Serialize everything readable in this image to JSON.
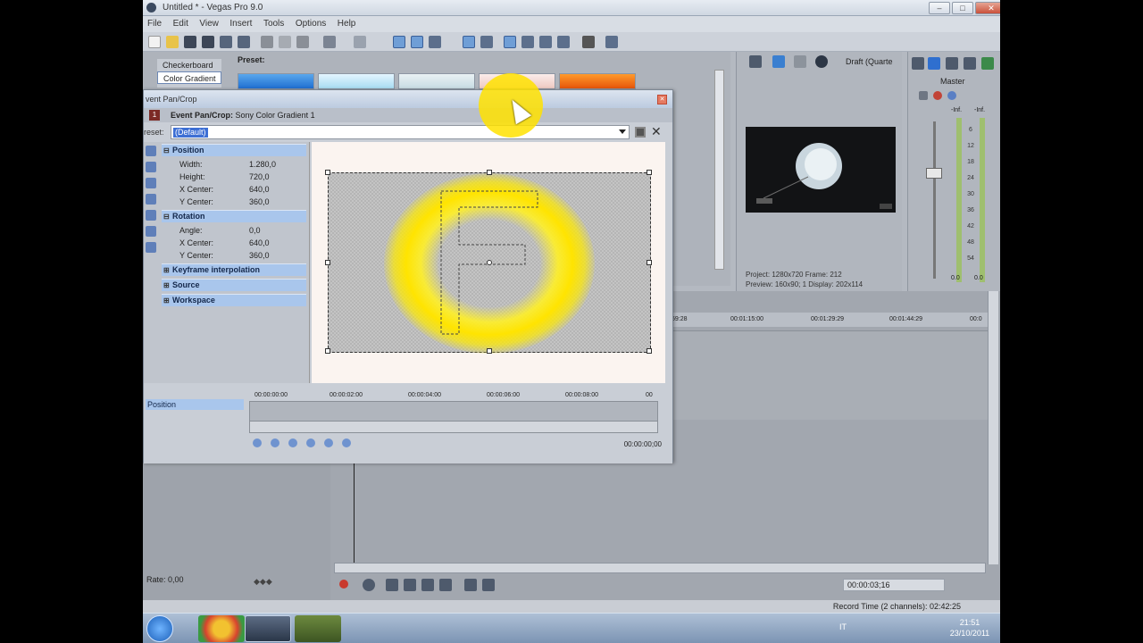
{
  "window": {
    "title": "Untitled * - Vegas Pro 9.0"
  },
  "menu": [
    "File",
    "Edit",
    "View",
    "Insert",
    "Tools",
    "Options",
    "Help"
  ],
  "media": {
    "tree": [
      "Checkerboard",
      "Color Gradient"
    ],
    "preset_label": "Preset:"
  },
  "preview": {
    "quality": "Draft (Quarte",
    "project_label": "Project:",
    "project_value": "1280x720",
    "frame_label": "Frame:",
    "frame_value": "212",
    "preview_label": "Preview:",
    "preview_value": "160x90; 1",
    "display_label": "Display:",
    "display_value": "202x114"
  },
  "master": {
    "label": "Master",
    "left_inf": "-Inf.",
    "right_inf": "-Inf.",
    "scale": [
      "6",
      "12",
      "18",
      "24",
      "30",
      "36",
      "42",
      "48",
      "54"
    ],
    "left_val": "0.0",
    "right_val": "0.0"
  },
  "dialog": {
    "title": "vent Pan/Crop",
    "event_number": "1",
    "event_label_bold": "Event Pan/Crop:",
    "event_label_rest": "Sony Color Gradient 1",
    "preset_label": "reset:",
    "preset_value": "(Default)",
    "categories": {
      "position": "Position",
      "rotation": "Rotation",
      "keyframe": "Keyframe interpolation",
      "source": "Source",
      "workspace": "Workspace"
    },
    "props": {
      "width_label": "Width:",
      "width_value": "1.280,0",
      "height_label": "Height:",
      "height_value": "720,0",
      "xcenter_label": "X Center:",
      "xcenter_value": "640,0",
      "ycenter_label": "Y Center:",
      "ycenter_value": "360,0",
      "angle_label": "Angle:",
      "angle_value": "0,0",
      "rot_xcenter_label": "X Center:",
      "rot_xcenter_value": "640,0",
      "rot_ycenter_label": "Y Center:",
      "rot_ycenter_value": "360,0"
    },
    "keyframes": {
      "track_label": "Position",
      "ruler": [
        "00:00:00:00",
        "00:00:02:00",
        "00:00:04:00",
        "00:00:06:00",
        "00:00:08:00",
        "00"
      ],
      "time": "00:00:00;00"
    }
  },
  "timeline": {
    "ruler": [
      "59:28",
      "00:01:15:00",
      "00:01:29:29",
      "00:01:44:29",
      "00:0"
    ],
    "rate": "Rate: 0,00",
    "timecode": "00:00:03;16",
    "record_time": "Record Time (2 channels): 02:42:25"
  },
  "taskbar": {
    "lang": "IT",
    "time": "21:51",
    "date": "23/10/2011"
  }
}
